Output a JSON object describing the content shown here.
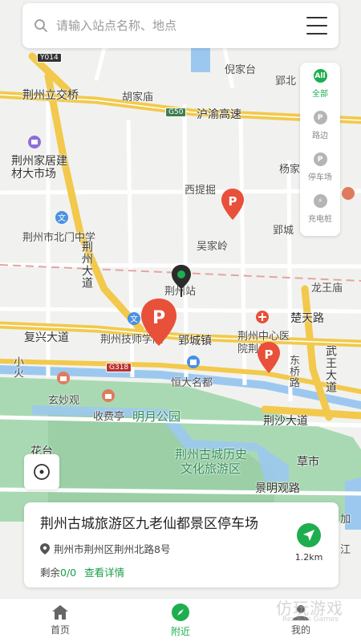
{
  "search": {
    "placeholder": "请输入站点名称、地点"
  },
  "filters": [
    {
      "icon": "All",
      "label": "全部",
      "active": true
    },
    {
      "icon": "P",
      "label": "路边",
      "active": false
    },
    {
      "icon": "P",
      "label": "停车场",
      "active": false
    },
    {
      "icon": "⚡",
      "label": "充电桩",
      "active": false
    }
  ],
  "map_labels": {
    "y014": "Y014",
    "nijiatai": "倪家台",
    "yingbei": "郢北",
    "lijiaoqiao": "荆州立交桥",
    "hujiamiao": "胡家庙",
    "g50": "G50",
    "huyu": "沪渝高速",
    "jiaju_1": "荆州家居建",
    "jiaju_2": "材大市场",
    "yangjia": "杨家",
    "xitijue": "西提掘",
    "beimen": "荆州市北门中学",
    "yingcheng": "郢城",
    "wujialing": "吴家岭",
    "jingzhou_avenue": "荆州大道",
    "station": "荆州站",
    "longwang": "龙王庙",
    "chulu": "楚天路",
    "fuxing": "复兴大道",
    "jishi": "荆州技师学院",
    "yingcheng_town": "郢城镇",
    "zhongxin_1": "荆州中心医",
    "zhongxin_2": "院荆州",
    "dongqiao": "东桥路",
    "wuwang": "武王大道",
    "g318": "G318",
    "xiaohuo": "小火",
    "hengda": "恒大名都",
    "xuanmiao": "玄妙观",
    "shoufei": "收费亭",
    "mingyue": "明月公园",
    "jingsha": "荆沙大道",
    "huatai": "花台",
    "gucheng_1": "荆州古城历史",
    "gucheng_2": "文化旅游区",
    "caoshi": "草市",
    "jingming": "景明观路",
    "s3": "S",
    "jia": "加",
    "jiang": "江"
  },
  "card": {
    "title": "荆州古城旅游区九老仙都景区停车场",
    "address": "荆州市荆州区荆州北路8号",
    "spaces_label": "剩余",
    "spaces_value": "0/0",
    "detail_link": "查看详情",
    "distance": "1.2km"
  },
  "tabs": [
    {
      "label": "首页",
      "active": false
    },
    {
      "label": "附近",
      "active": true
    },
    {
      "label": "我的",
      "active": false
    }
  ],
  "watermark": {
    "text": "仿玩游戏",
    "sub": "Renwan Games"
  },
  "colors": {
    "accent": "#1fae4f",
    "marker": "#e8503a",
    "highway": "#f2c94c",
    "water": "#9cc8f0",
    "park": "#a8d8b0"
  }
}
